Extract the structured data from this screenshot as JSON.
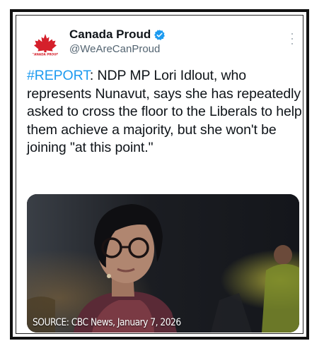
{
  "account": {
    "name": "Canada Proud",
    "handle": "@WeAreCanProud",
    "avatar_icon": "canada-proud-maple-leaf-logo",
    "avatar_logo_text": "CANADA PROUD",
    "verified_icon": "verified-badge-icon",
    "verified_color": "#1d9bf0"
  },
  "menu_icon": "more-options-icon",
  "post": {
    "hashtag": "#REPORT",
    "body": ": NDP MP Lori Idlout, who represents Nunavut, says she has repeatedly asked to cross the floor to the Liberals to help them achieve a majority, but she won't be joining \"at this point.\""
  },
  "media": {
    "caption": "SOURCE: CBC News, January 7, 2026"
  },
  "colors": {
    "hashtag": "#1d9bf0",
    "text": "#0f1419",
    "secondary": "#536471"
  }
}
